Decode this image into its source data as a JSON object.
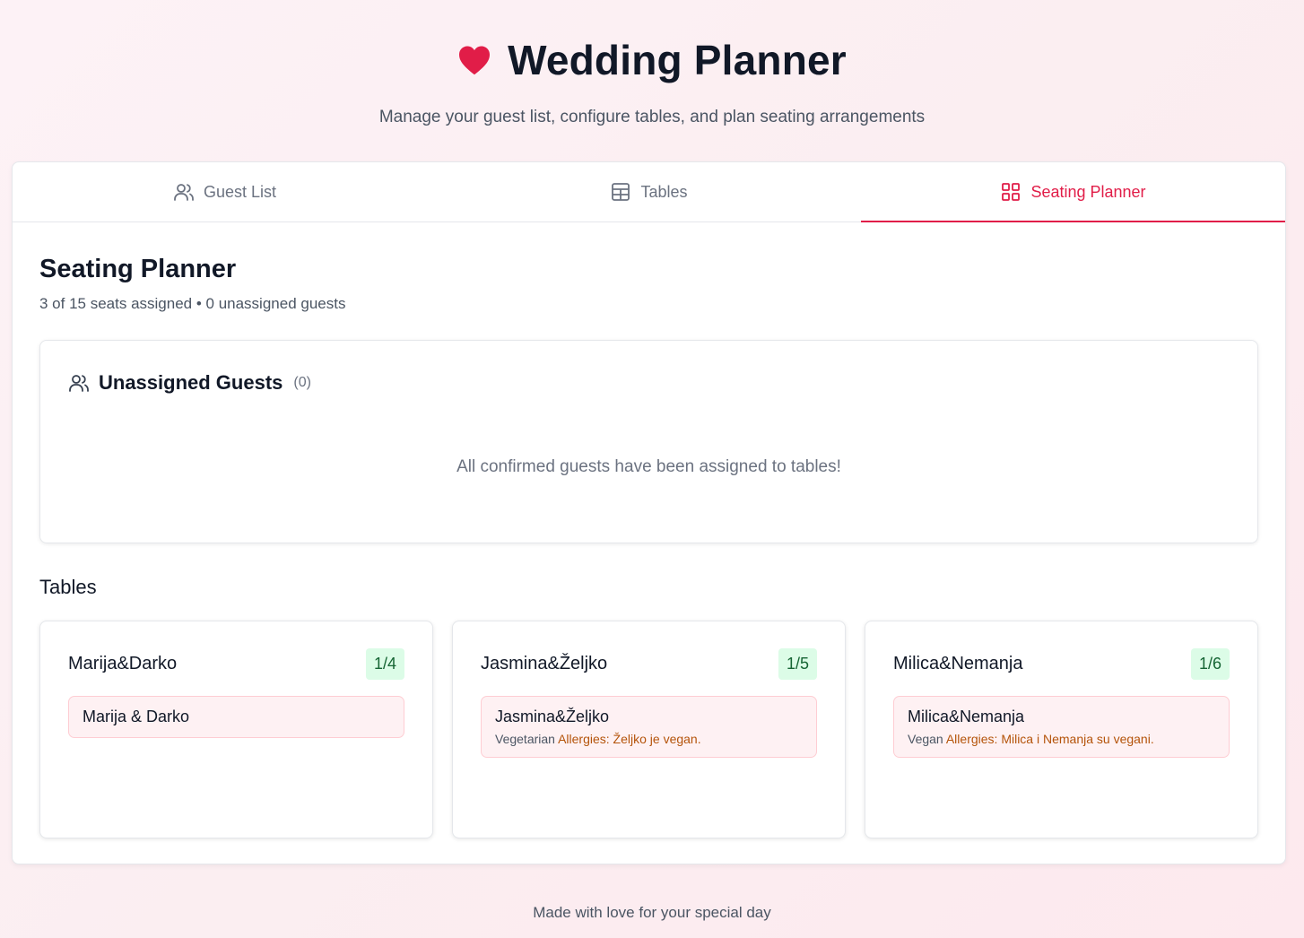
{
  "header": {
    "title": "Wedding Planner",
    "subtitle": "Manage your guest list, configure tables, and plan seating arrangements",
    "icon": "heart-icon"
  },
  "tabs": [
    {
      "label": "Guest List",
      "icon": "users-icon",
      "active": false
    },
    {
      "label": "Tables",
      "icon": "table-icon",
      "active": false
    },
    {
      "label": "Seating Planner",
      "icon": "grid-icon",
      "active": true
    }
  ],
  "seating": {
    "title": "Seating Planner",
    "summary": "3 of 15 seats assigned • 0 unassigned guests"
  },
  "unassigned": {
    "title": "Unassigned Guests",
    "count": "(0)",
    "empty_message": "All confirmed guests have been assigned to tables!"
  },
  "tables_title": "Tables",
  "tables": [
    {
      "name": "Marija&Darko",
      "occupancy": "1/4",
      "guests": [
        {
          "name": "Marija & Darko",
          "diet": "",
          "allergies": ""
        }
      ]
    },
    {
      "name": "Jasmina&Željko",
      "occupancy": "1/5",
      "guests": [
        {
          "name": "Jasmina&Željko",
          "diet": "Vegetarian",
          "allergies": "Allergies: Željko je vegan."
        }
      ]
    },
    {
      "name": "Milica&Nemanja",
      "occupancy": "1/6",
      "guests": [
        {
          "name": "Milica&Nemanja",
          "diet": "Vegan",
          "allergies": "Allergies: Milica i Nemanja su vegani."
        }
      ]
    }
  ],
  "footer": "Made with love for your special day",
  "colors": {
    "accent": "#e11d48",
    "badge_bg": "#dcfce7",
    "badge_text": "#166534",
    "guest_bg": "#fef1f3",
    "allergy": "#b45309"
  }
}
